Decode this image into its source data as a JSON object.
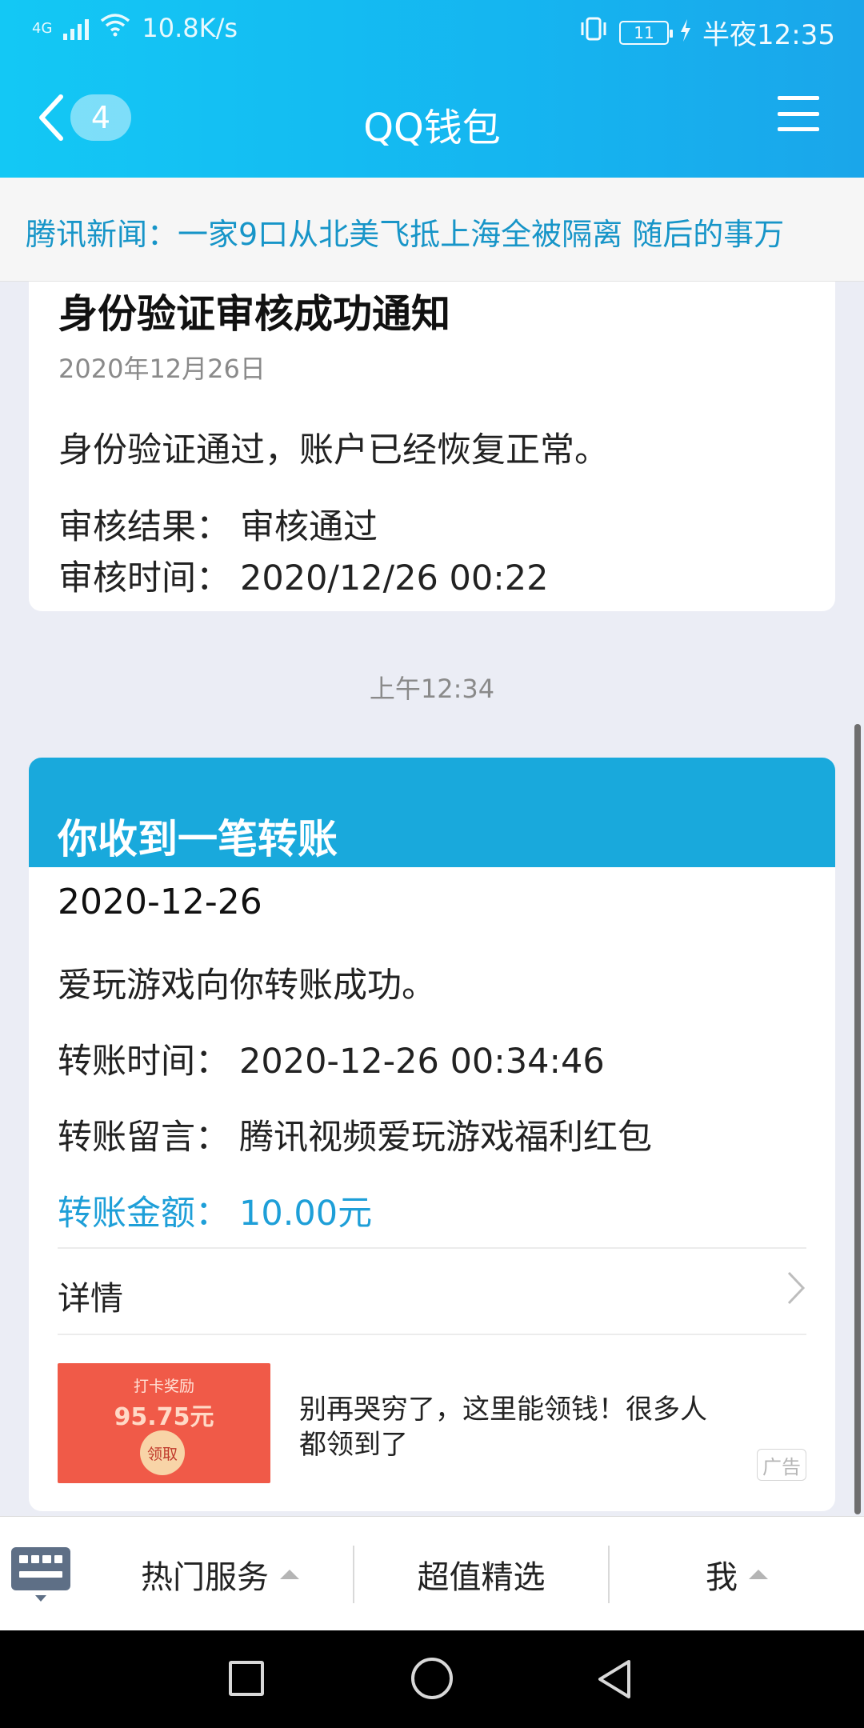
{
  "status_bar": {
    "network": "4G",
    "speed": "10.8K/s",
    "battery": "11",
    "time": "半夜12:35"
  },
  "navbar": {
    "back_badge": "4",
    "title": "QQ钱包"
  },
  "ticker": {
    "text": "腾讯新闻：一家9口从北美飞抵上海全被隔离 随后的事万"
  },
  "card_verification": {
    "title": "身份验证审核成功通知",
    "date": "2020年12月26日",
    "message": "身份验证通过，账户已经恢复正常。",
    "result_label": "审核结果：",
    "result_value": "审核通过",
    "time_label": "审核时间：",
    "time_value": "2020/12/26 00:22"
  },
  "timestamp": "上午12:34",
  "card_transfer": {
    "title": "你收到一笔转账",
    "date": "2020-12-26",
    "message": "爱玩游戏向你转账成功。",
    "time_label": "转账时间：",
    "time_value": "2020-12-26 00:34:46",
    "note_label": "转账留言：",
    "note_value": "腾讯视频爱玩游戏福利红包",
    "amount_label": "转账金额：",
    "amount_value": "10.00元",
    "details_label": "详情"
  },
  "ad": {
    "image_caption": "打卡奖励",
    "image_amount": "95.75元",
    "image_button": "领取",
    "text": "别再哭穷了，这里能领钱！很多人都领到了",
    "tag": "广告"
  },
  "bottom_bar": {
    "hot_services": "热门服务",
    "deals": "超值精选",
    "me": "我"
  },
  "colors": {
    "header": "#15b5f0",
    "transfer_header": "#19a9dc",
    "amount": "#1e9fd8",
    "ticker_text": "#1795c8"
  }
}
